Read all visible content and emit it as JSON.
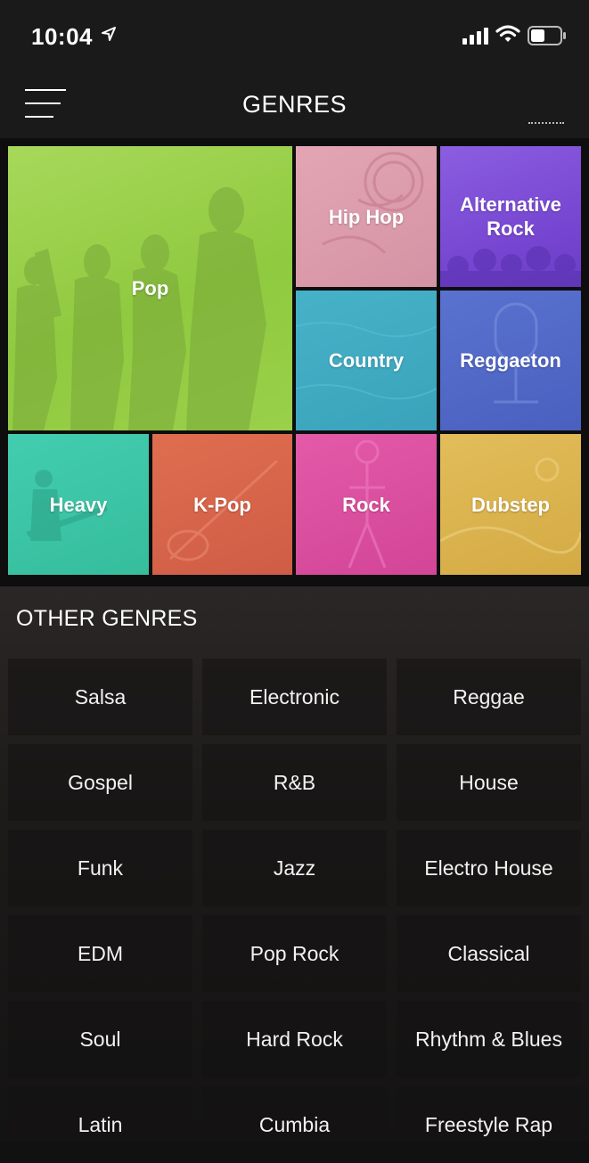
{
  "status_bar": {
    "time": "10:04"
  },
  "header": {
    "title": "GENRES"
  },
  "featured": [
    {
      "label": "Pop",
      "color": "#9fd24d"
    },
    {
      "label": "Hip Hop",
      "color": "#d99aa9"
    },
    {
      "label": "Alternative Rock",
      "color": "#7e4fd6"
    },
    {
      "label": "Country",
      "color": "#3fa9c1"
    },
    {
      "label": "Reggaeton",
      "color": "#4e67c6"
    },
    {
      "label": "Heavy",
      "color": "#3cc4a4"
    },
    {
      "label": "K-Pop",
      "color": "#d8654a"
    },
    {
      "label": "Rock",
      "color": "#d94e9f"
    },
    {
      "label": "Dubstep",
      "color": "#dcb54f"
    }
  ],
  "other_genres": {
    "title": "OTHER GENRES",
    "items": [
      "Salsa",
      "Electronic",
      "Reggae",
      "Gospel",
      "R&B",
      "House",
      "Funk",
      "Jazz",
      "Electro House",
      "EDM",
      "Pop Rock",
      "Classical",
      "Soul",
      "Hard Rock",
      "Rhythm & Blues",
      "Latin",
      "Cumbia",
      "Freestyle Rap"
    ]
  }
}
